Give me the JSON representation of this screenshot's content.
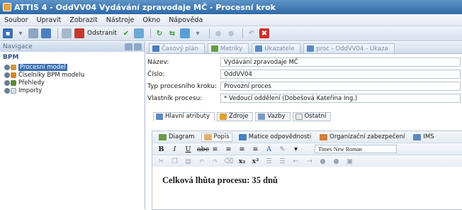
{
  "window": {
    "title": "ATTIS 4 - OddVV04 Vydávání zpravodaje MČ - Procesní krok"
  },
  "menu": [
    "Soubor",
    "Upravit",
    "Zobrazit",
    "Nástroje",
    "Okno",
    "Nápověda"
  ],
  "toolbar": {
    "delete_label": "Odstranit"
  },
  "nav": {
    "header": "Navigace",
    "section": "BPM",
    "items": [
      {
        "label": "Procesní model",
        "selected": true
      },
      {
        "label": "Číselníky BPM modelu",
        "selected": false
      },
      {
        "label": "Přehledy",
        "selected": false
      },
      {
        "label": "Importy",
        "selected": false
      }
    ]
  },
  "tabs": [
    "Časový plán",
    "Metriky",
    "Ukazatele",
    "proc - OddVV04 - Ukaza"
  ],
  "form": {
    "name_label": "Název:",
    "name_value": "Vydávání zpravodaje MČ",
    "number_label": "Číslo:",
    "number_value": "OddVV04",
    "type_label": "Typ procesního kroku:",
    "type_value": "Provozní proces",
    "owner_label": "Vlastník procesu:",
    "owner_value": "* Vedoucí oddělení (Dobešová Kateřina Ing.)"
  },
  "subtabs": [
    "Hlavní atributy",
    "Zdroje",
    "Vazby",
    "Ostatní"
  ],
  "panel_tabs": [
    "Diagram",
    "Popis",
    "Matice odpovědnosti",
    "Organizační zabezpečení",
    "IMS"
  ],
  "editor": {
    "font": "Times New Roman",
    "content": "Celková lhůta procesu: 35 dnů"
  },
  "colors": {
    "titlebar": "#2f69a6",
    "selection": "#3a6fb0"
  }
}
